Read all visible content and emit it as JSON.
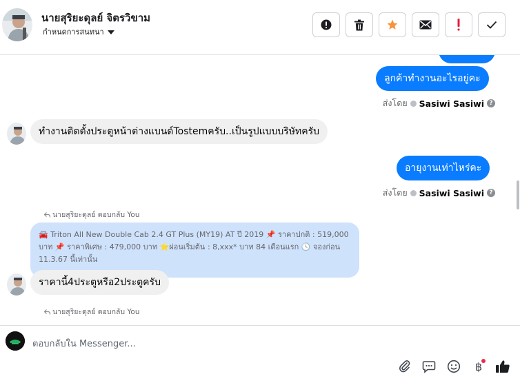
{
  "header": {
    "name": "นายสุริยะดุลย์ จิตรวิขาม",
    "subtitle": "กำหนดการสนทนา",
    "buttons": [
      {
        "icon": "alert-circle-icon"
      },
      {
        "icon": "trash-icon"
      },
      {
        "icon": "star-icon"
      },
      {
        "icon": "envelope-icon"
      },
      {
        "icon": "exclamation-icon"
      },
      {
        "icon": "check-icon"
      }
    ]
  },
  "messages": {
    "out_1": "ลูกค้าทำงานอะไรอยู่คะ",
    "sent_by_1": {
      "prefix": "ส่งโดย",
      "name": "Sasiwi Sasiwi"
    },
    "in_1": "ทำงานติดตั้งประตูหน้าต่างแบนด์Tostemครับ..เป็นรูปแบบบริษัทครับ",
    "out_2": "อายุงานเท่าไหร่คะ",
    "sent_by_2": {
      "prefix": "ส่งโดย",
      "name": "Sasiwi Sasiwi"
    },
    "reply_note_1": "นายสุริยะดุลย์ ตอบกลับ You",
    "quoted": {
      "line1": "Triton All New Double Cab 2.4 GT Plus (MY19) AT ปี 2019",
      "line1b": "ราคาปกติ : 519,000",
      "line2a": "บาท",
      "line2b": "ราคาพิเศษ : 479,000 บาท",
      "line2c": "ผ่อนเริ่มต้น : 8,xxx* บาท 84 เดือนแรก",
      "line2d": "จองก่อน",
      "line3": "11.3.67 นี้เท่านั้น"
    },
    "in_2": "ราคานี้4ประตูหรือ2ประตูครับ",
    "reply_note_2": "นายสุริยะดุลย์ ตอบกลับ You"
  },
  "composer": {
    "placeholder": "ตอบกลับใน Messenger...",
    "icons": [
      "paperclip-icon",
      "speech-bubble-icon",
      "smiley-icon",
      "baht-icon",
      "thumbs-up-icon"
    ]
  },
  "colors": {
    "outgoing": "#0a7cff",
    "incoming": "#f0f0f0",
    "quoted": "#cfe2fc",
    "star": "#f7923b",
    "exclamation": "#e41e3f"
  }
}
